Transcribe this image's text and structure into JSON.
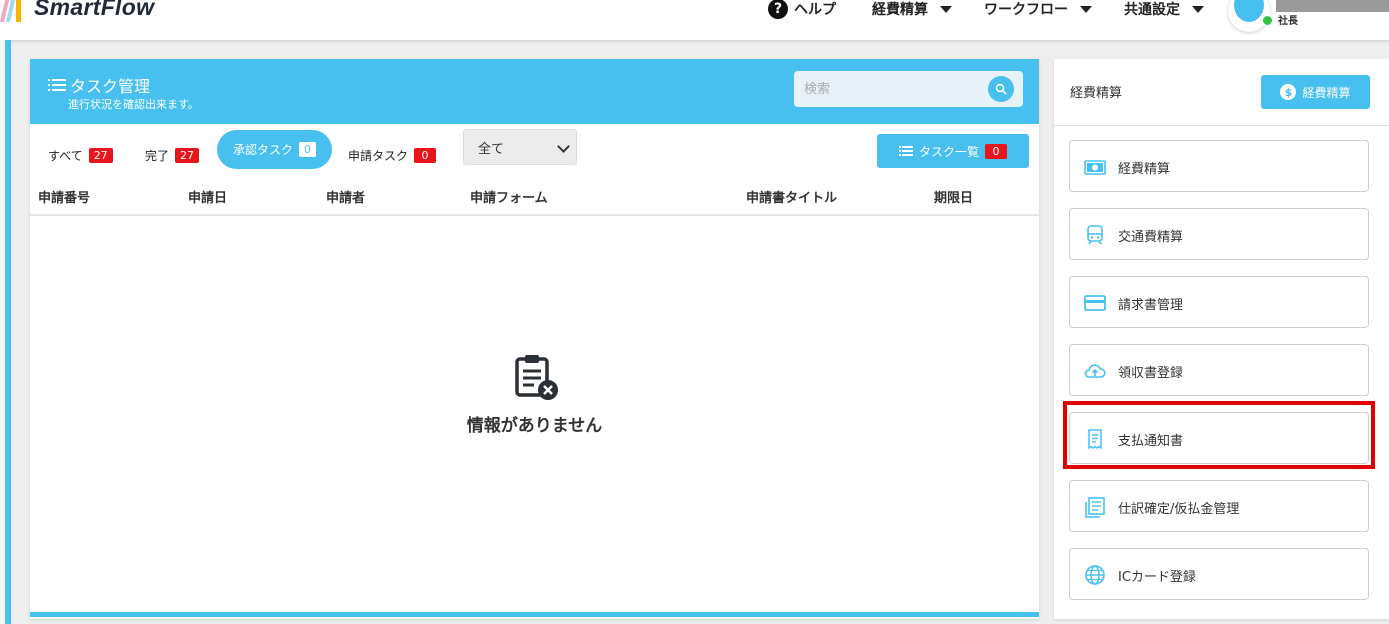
{
  "app": {
    "name": "SmartFlow"
  },
  "topnav": {
    "help_label": "ヘルプ",
    "items": [
      {
        "label": "経費精算"
      },
      {
        "label": "ワークフロー"
      },
      {
        "label": "共通設定"
      }
    ],
    "user_role": "社長"
  },
  "task_panel": {
    "title": "タスク管理",
    "subtitle": "進行状況を確認出来ます。",
    "search_placeholder": "検索",
    "filters": [
      {
        "label": "すべて",
        "count": "27"
      },
      {
        "label": "完了",
        "count": "27"
      },
      {
        "label": "承認タスク",
        "count": "0"
      },
      {
        "label": "申請タスク",
        "count": "0"
      }
    ],
    "select_value": "全て",
    "task_list_button": {
      "label": "タスク一覧",
      "count": "0"
    },
    "columns": [
      "申請番号",
      "申請日",
      "申請者",
      "申請フォーム",
      "申請書タイトル",
      "期限日"
    ],
    "empty_message": "情報がありません"
  },
  "side_panel": {
    "title": "経費精算",
    "button_label": "経費精算",
    "menu": [
      {
        "label": "経費精算",
        "icon": "money-icon"
      },
      {
        "label": "交通費精算",
        "icon": "train-icon"
      },
      {
        "label": "請求書管理",
        "icon": "credit-card-icon"
      },
      {
        "label": "領収書登録",
        "icon": "cloud-upload-icon"
      },
      {
        "label": "支払通知書",
        "icon": "receipt-icon"
      },
      {
        "label": "仕訳確定/仮払金管理",
        "icon": "journal-icon"
      },
      {
        "label": "ICカード登録",
        "icon": "globe-icon"
      }
    ]
  },
  "colors": {
    "accent": "#48c0ef",
    "badge": "#e8151b",
    "highlight": "#e00000"
  }
}
